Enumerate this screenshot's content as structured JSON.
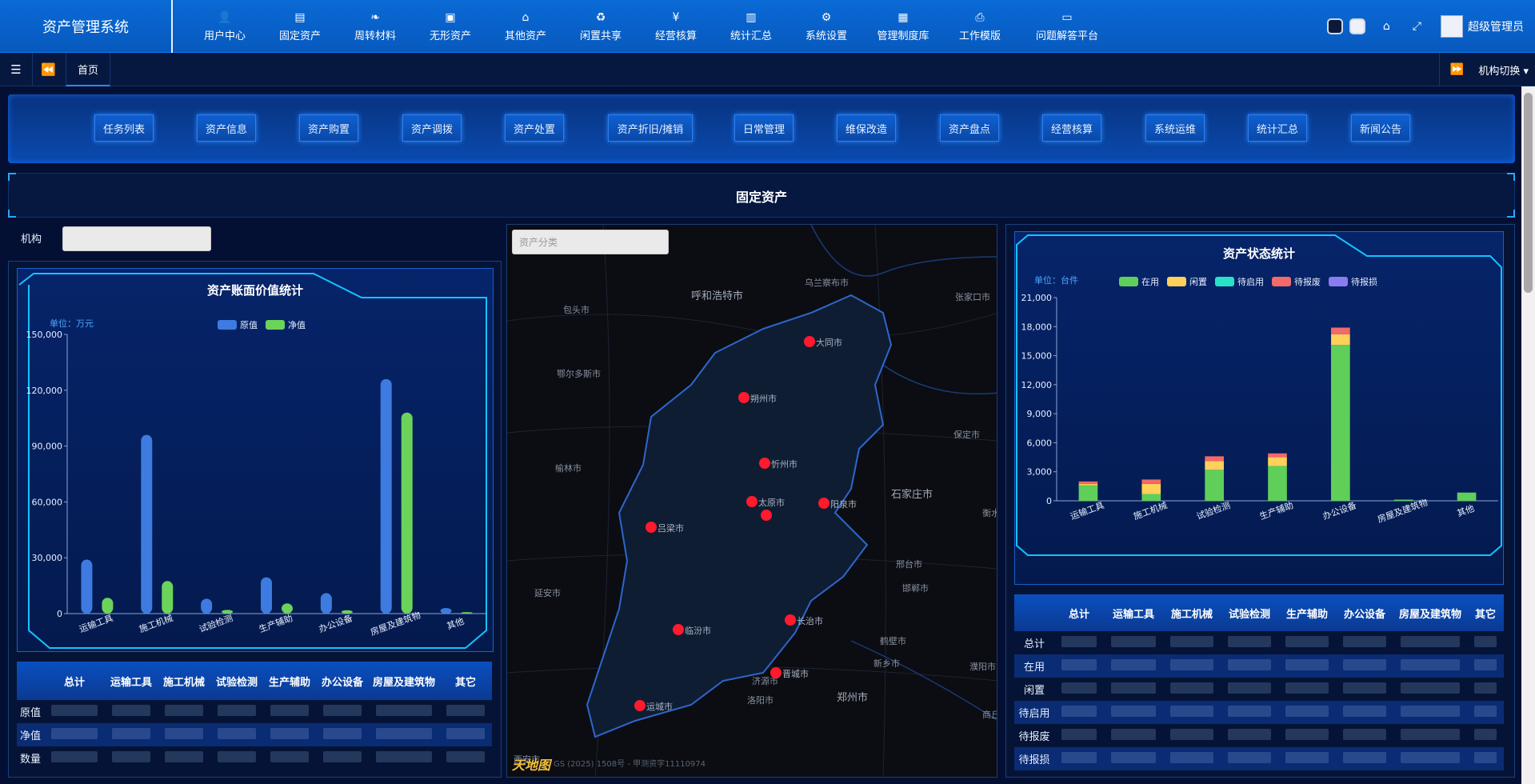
{
  "app": {
    "title": "资产管理系统"
  },
  "topmenu": [
    {
      "label": "用户中心",
      "icon": "user-icon",
      "glyph": "👤"
    },
    {
      "label": "固定资产",
      "icon": "document-icon",
      "glyph": "▤"
    },
    {
      "label": "周转材料",
      "icon": "leaf-icon",
      "glyph": "❧"
    },
    {
      "label": "无形资产",
      "icon": "save-icon",
      "glyph": "▣"
    },
    {
      "label": "其他资产",
      "icon": "bank-icon",
      "glyph": "⌂"
    },
    {
      "label": "闲置共享",
      "icon": "recycle-icon",
      "glyph": "♻"
    },
    {
      "label": "经营核算",
      "icon": "yen-icon",
      "glyph": "¥"
    },
    {
      "label": "统计汇总",
      "icon": "bar-chart-icon",
      "glyph": "▥"
    },
    {
      "label": "系统设置",
      "icon": "gears-icon",
      "glyph": "⚙"
    },
    {
      "label": "管理制度库",
      "icon": "grid-icon",
      "glyph": "▦"
    },
    {
      "label": "工作模版",
      "icon": "print-icon",
      "glyph": "⎙"
    },
    {
      "label": "问题解答平台",
      "icon": "monitor-icon",
      "glyph": "▭"
    }
  ],
  "topright": {
    "user": "超级管理员",
    "home_glyph": "⌂",
    "fullscreen_glyph": "⤢"
  },
  "tabbar": {
    "home": "首页",
    "org_switch": "机构切换 ▾",
    "menu_glyph": "☰",
    "back_glyph": "⏪",
    "fwd_glyph": "⏩"
  },
  "quick": [
    "任务列表",
    "资产信息",
    "资产购置",
    "资产调拨",
    "资产处置",
    "资产折旧/摊销",
    "日常管理",
    "维保改造",
    "资产盘点",
    "经营核算",
    "系统运维",
    "统计汇总",
    "新闻公告"
  ],
  "section_title": "固定资产",
  "filters": {
    "org_label": "机构",
    "category_placeholder": "资产分类"
  },
  "left_chart_title": "资产账面价值统计",
  "left_chart_unit": "单位：万元",
  "right_chart_title": "资产状态统计",
  "right_chart_unit": "单位：台件",
  "left_table": {
    "headers": [
      "",
      "总计",
      "运输工具",
      "施工机械",
      "试验检测",
      "生产辅助",
      "办公设备",
      "房屋及建筑物",
      "其它"
    ],
    "rows": [
      "原值",
      "净值",
      "数量"
    ]
  },
  "right_table": {
    "headers": [
      "",
      "总计",
      "运输工具",
      "施工机械",
      "试验检测",
      "生产辅助",
      "办公设备",
      "房屋及建筑物",
      "其它"
    ],
    "rows": [
      "总计",
      "在用",
      "闲置",
      "待启用",
      "待报废",
      "待报损"
    ]
  },
  "map": {
    "cities": [
      {
        "name": "呼和浩特市",
        "big": true
      },
      {
        "name": "乌兰察布市",
        "big": false
      },
      {
        "name": "包头市",
        "big": false
      },
      {
        "name": "张家口市",
        "big": false
      },
      {
        "name": "鄂尔多斯市",
        "big": false
      },
      {
        "name": "保定市",
        "big": false
      },
      {
        "name": "榆林市",
        "big": false
      },
      {
        "name": "石家庄市",
        "big": true
      },
      {
        "name": "衡水",
        "big": false
      },
      {
        "name": "延安市",
        "big": false
      },
      {
        "name": "邢台市",
        "big": false
      },
      {
        "name": "邯郸市",
        "big": false
      },
      {
        "name": "鹤壁市",
        "big": false
      },
      {
        "name": "新乡市",
        "big": false
      },
      {
        "name": "济源市",
        "big": false
      },
      {
        "name": "洛阳市",
        "big": false
      },
      {
        "name": "郑州市",
        "big": true
      },
      {
        "name": "濮阳市",
        "big": false
      },
      {
        "name": "商丘",
        "big": false
      },
      {
        "name": "西安市",
        "big": false
      }
    ],
    "markers": [
      "大同市",
      "朔州市",
      "忻州市",
      "太原市",
      "",
      "阳泉市",
      "吕梁市",
      "长治市",
      "临汾市",
      "晋城市",
      "运城市"
    ],
    "copyright": "GS (2025) 1508号 - 甲测资字11110974",
    "logo": "天地图"
  },
  "chart_data": [
    {
      "type": "bar",
      "title": "资产账面价值统计",
      "categories": [
        "运输工具",
        "施工机械",
        "试验检测",
        "生产辅助",
        "办公设备",
        "房屋及建筑物",
        "其他"
      ],
      "series": [
        {
          "name": "原值",
          "color": "#3d7be0",
          "values": [
            29000,
            96000,
            8000,
            19500,
            11000,
            126000,
            3000
          ]
        },
        {
          "name": "净值",
          "color": "#6bd35a",
          "values": [
            8500,
            17500,
            2000,
            5500,
            1800,
            108000,
            800
          ]
        }
      ],
      "yticks": [
        "0",
        "30,000",
        "60,000",
        "90,000",
        "120,000",
        "150,000"
      ],
      "ylim": [
        0,
        150000
      ]
    },
    {
      "type": "bar",
      "stacked": true,
      "title": "资产状态统计",
      "categories": [
        "运输工具",
        "施工机械",
        "试验检测",
        "生产辅助",
        "办公设备",
        "房屋及建筑物",
        "其他"
      ],
      "series": [
        {
          "name": "在用",
          "color": "#5fcf5a",
          "values": [
            1600,
            700,
            3200,
            3600,
            16100,
            120,
            850
          ]
        },
        {
          "name": "闲置",
          "color": "#ffd05a",
          "values": [
            150,
            1050,
            900,
            900,
            1100,
            0,
            0
          ]
        },
        {
          "name": "待启用",
          "color": "#2ae0c8",
          "values": [
            0,
            0,
            0,
            0,
            0,
            0,
            0
          ]
        },
        {
          "name": "待报废",
          "color": "#f26a6a",
          "values": [
            250,
            450,
            500,
            400,
            700,
            0,
            0
          ]
        },
        {
          "name": "待报损",
          "color": "#8a7bf0",
          "values": [
            0,
            0,
            0,
            0,
            0,
            0,
            0
          ]
        }
      ],
      "yticks": [
        "0",
        "3,000",
        "6,000",
        "9,000",
        "12,000",
        "15,000",
        "18,000",
        "21,000"
      ],
      "ylim": [
        0,
        21000
      ]
    }
  ]
}
